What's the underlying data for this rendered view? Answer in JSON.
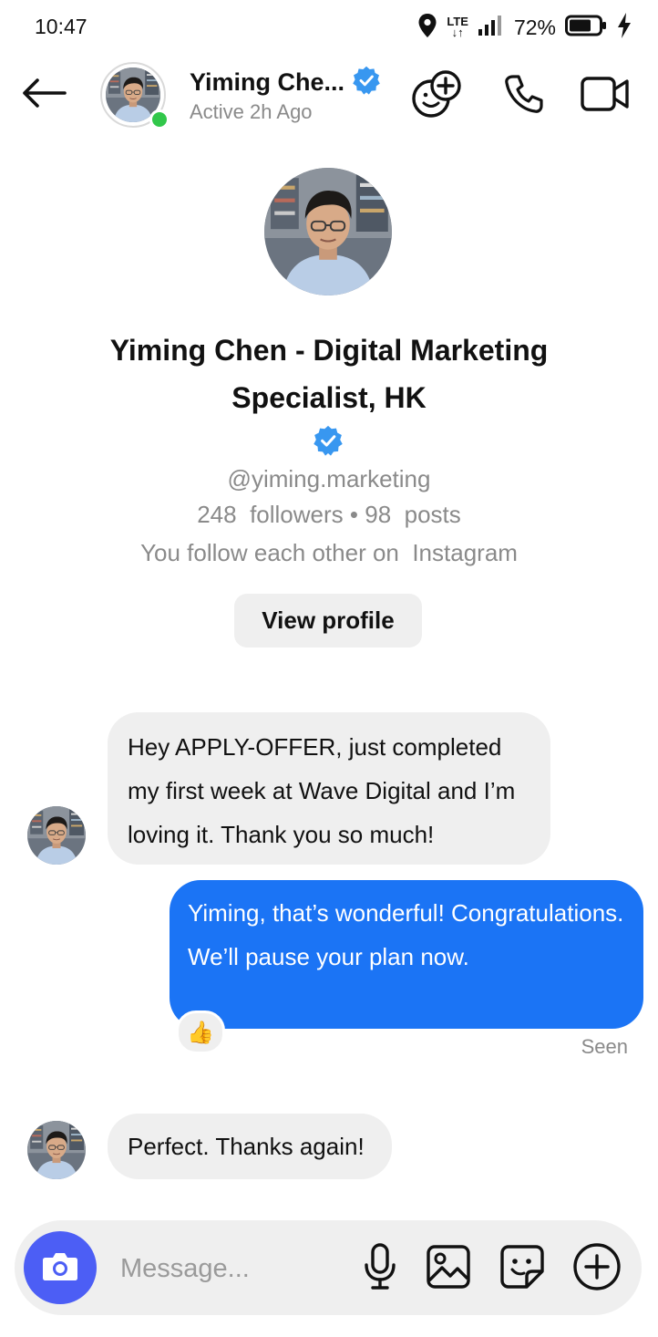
{
  "status_bar": {
    "time": "10:47",
    "network": "LTE",
    "battery_percent": "72%"
  },
  "header": {
    "name": "Yiming Che...",
    "active_status": "Active 2h Ago",
    "online": true,
    "icons": [
      "back-arrow-icon",
      "verified-badge-icon",
      "add-people-icon",
      "phone-icon",
      "video-icon"
    ]
  },
  "profile": {
    "full_name": "Yiming Chen - Digital Marketing Specialist, HK",
    "verified": true,
    "handle": "@yiming.marketing",
    "followers_count": "248",
    "followers_label": "followers",
    "posts_count": "98",
    "posts_label": "posts",
    "mutual_text": "You follow each other on",
    "mutual_platform": "Instagram",
    "view_profile_label": "View profile"
  },
  "messages": [
    {
      "from": "them",
      "text": "Hey APPLY-OFFER, just completed my first week at Wave Digital and I’m loving it. Thank you so much!"
    },
    {
      "from": "me",
      "text": "Yiming, that’s wonderful! Congratulations. We’ll pause your plan now.",
      "reaction": "👍",
      "status": "Seen"
    },
    {
      "from": "them",
      "text": "Perfect. Thanks again!"
    }
  ],
  "composer": {
    "placeholder": "Message...",
    "icons": [
      "camera-icon",
      "microphone-icon",
      "gallery-icon",
      "sticker-icon",
      "plus-circle-icon"
    ]
  },
  "colors": {
    "accent_blue": "#1b74f5",
    "camera_button": "#4c5ef5",
    "verified_blue": "#3897f0",
    "online_green": "#31c74a",
    "incoming_bubble": "#efefef",
    "secondary_text": "#8a8a8a"
  }
}
